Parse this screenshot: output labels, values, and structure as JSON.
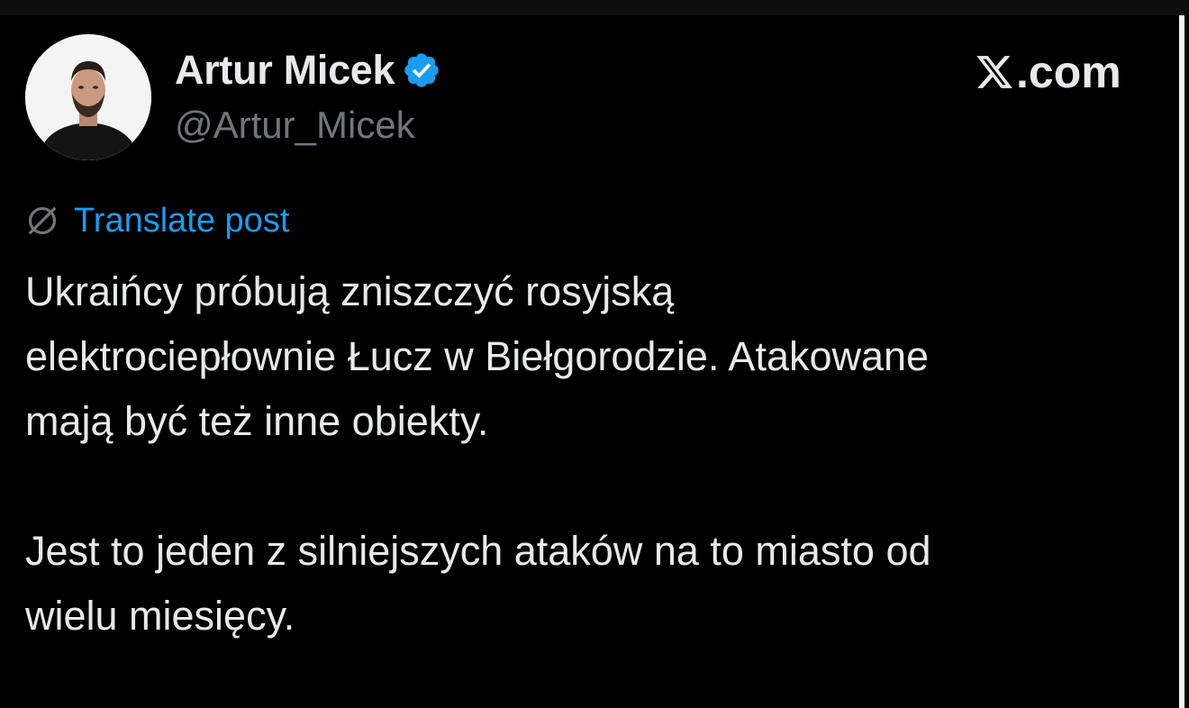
{
  "post": {
    "author": {
      "name": "Artur Micek",
      "handle": "@Artur_Micek",
      "verified": true,
      "verified_color": "#1d9bf0"
    },
    "brand": {
      "icon": "x-logo-icon",
      "label": ".com"
    },
    "translate": {
      "icon": "globe-slash-icon",
      "label": "Translate post",
      "color": "#1d9bf0"
    },
    "paragraphs": [
      "Ukraińcy próbują zniszczyć rosyjską\nelektrociepłownie Łucz w Biełgorodzie. Atakowane\nmają być też inne obiekty.",
      "Jest to jeden z silniejszych ataków na to miasto od\nwielu miesięcy."
    ]
  },
  "colors": {
    "background": "#000000",
    "text_primary": "#e7e9ea",
    "text_secondary": "#71767b",
    "accent": "#1d9bf0"
  }
}
